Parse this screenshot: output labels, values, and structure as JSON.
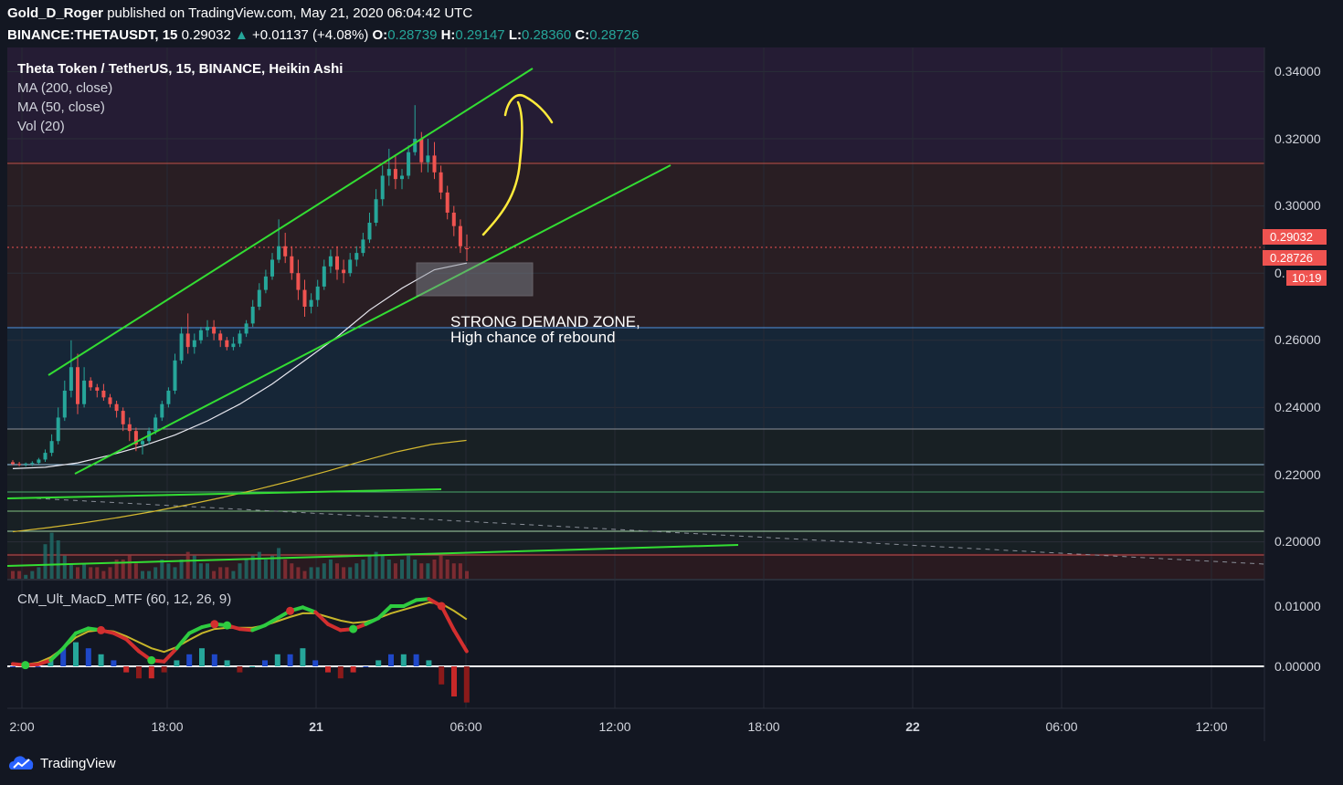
{
  "header": {
    "author": "Gold_D_Roger",
    "published": "published on TradingView.com, May 21, 2020 06:04:42 UTC",
    "symbol": "BINANCE:THETAUSDT, 15",
    "last": "0.29032",
    "change": "+0.01137 (+4.08%)",
    "open_label": "O:",
    "open": "0.28739",
    "high_label": "H:",
    "high": "0.29147",
    "low_label": "L:",
    "low": "0.28360",
    "close_label": "C:",
    "close": "0.28726"
  },
  "legend": {
    "title": "Theta Token / TetherUS, 15, BINANCE, Heikin Ashi",
    "ma200": "MA (200, close)",
    "ma50": "MA (50, close)",
    "vol": "Vol (20)",
    "macd": "CM_Ult_MacD_MTF (60, 12, 26, 9)"
  },
  "annotation": {
    "line1": "STRONG DEMAND ZONE,",
    "line2": "High chance of rebound"
  },
  "price_axis": {
    "ticks": [
      "0.34000",
      "0.32000",
      "0.30000",
      "0.26000",
      "0.24000",
      "0.22000",
      "0.20000"
    ],
    "badge_last": "0.29032",
    "badge_close": "0.28726",
    "badge_timer": "10:19",
    "partial": "0."
  },
  "macd_axis": {
    "ticks": [
      "0.01000",
      "0.00000"
    ]
  },
  "time_axis": {
    "ticks": [
      "2:00",
      "18:00",
      "21",
      "06:00",
      "12:00",
      "18:00",
      "22",
      "06:00",
      "12:00"
    ]
  },
  "brand": "TradingView",
  "colors": {
    "background": "#131722",
    "up": "#26a69a",
    "down": "#ef5350",
    "channel": "#33dd33",
    "ma200": "#d4b830",
    "ma50": "#e8e8f0",
    "annotation_arrow": "#ffeb3b"
  },
  "chart_data": {
    "type": "candlestick",
    "title": "Theta Token / TetherUS, 15, BINANCE, Heikin Ashi",
    "ylim": [
      0.19,
      0.345
    ],
    "candles": [
      [
        0.2237,
        0.2243,
        0.2228,
        0.2232
      ],
      [
        0.2232,
        0.2238,
        0.2225,
        0.223
      ],
      [
        0.223,
        0.2236,
        0.2224,
        0.2233
      ],
      [
        0.2233,
        0.224,
        0.2226,
        0.2235
      ],
      [
        0.2235,
        0.225,
        0.223,
        0.2245
      ],
      [
        0.2245,
        0.2275,
        0.2238,
        0.2265
      ],
      [
        0.2265,
        0.232,
        0.2255,
        0.23
      ],
      [
        0.23,
        0.24,
        0.229,
        0.237
      ],
      [
        0.237,
        0.248,
        0.236,
        0.245
      ],
      [
        0.245,
        0.26,
        0.243,
        0.252
      ],
      [
        0.252,
        0.256,
        0.238,
        0.241
      ],
      [
        0.241,
        0.252,
        0.24,
        0.248
      ],
      [
        0.248,
        0.249,
        0.245,
        0.246
      ],
      [
        0.246,
        0.247,
        0.243,
        0.245
      ],
      [
        0.245,
        0.247,
        0.242,
        0.243
      ],
      [
        0.243,
        0.244,
        0.24,
        0.241
      ],
      [
        0.241,
        0.242,
        0.237,
        0.239
      ],
      [
        0.239,
        0.24,
        0.233,
        0.235
      ],
      [
        0.235,
        0.237,
        0.23,
        0.233
      ],
      [
        0.233,
        0.234,
        0.227,
        0.229
      ],
      [
        0.229,
        0.231,
        0.226,
        0.23
      ],
      [
        0.23,
        0.234,
        0.229,
        0.233
      ],
      [
        0.233,
        0.238,
        0.232,
        0.237
      ],
      [
        0.237,
        0.242,
        0.236,
        0.241
      ],
      [
        0.241,
        0.246,
        0.24,
        0.245
      ],
      [
        0.245,
        0.256,
        0.244,
        0.254
      ],
      [
        0.254,
        0.264,
        0.253,
        0.262
      ],
      [
        0.262,
        0.268,
        0.256,
        0.258
      ],
      [
        0.258,
        0.262,
        0.256,
        0.26
      ],
      [
        0.26,
        0.264,
        0.259,
        0.263
      ],
      [
        0.263,
        0.266,
        0.261,
        0.264
      ],
      [
        0.264,
        0.266,
        0.26,
        0.262
      ],
      [
        0.262,
        0.263,
        0.258,
        0.26
      ],
      [
        0.26,
        0.261,
        0.257,
        0.258
      ],
      [
        0.258,
        0.261,
        0.257,
        0.259
      ],
      [
        0.259,
        0.263,
        0.258,
        0.262
      ],
      [
        0.262,
        0.266,
        0.261,
        0.265
      ],
      [
        0.265,
        0.272,
        0.264,
        0.27
      ],
      [
        0.27,
        0.277,
        0.269,
        0.275
      ],
      [
        0.275,
        0.281,
        0.274,
        0.279
      ],
      [
        0.279,
        0.286,
        0.278,
        0.284
      ],
      [
        0.284,
        0.296,
        0.283,
        0.288
      ],
      [
        0.288,
        0.292,
        0.283,
        0.285
      ],
      [
        0.285,
        0.288,
        0.278,
        0.28
      ],
      [
        0.28,
        0.284,
        0.272,
        0.275
      ],
      [
        0.275,
        0.278,
        0.267,
        0.27
      ],
      [
        0.27,
        0.274,
        0.268,
        0.272
      ],
      [
        0.272,
        0.278,
        0.27,
        0.276
      ],
      [
        0.276,
        0.284,
        0.275,
        0.282
      ],
      [
        0.282,
        0.287,
        0.28,
        0.285
      ],
      [
        0.285,
        0.288,
        0.278,
        0.281
      ],
      [
        0.281,
        0.284,
        0.277,
        0.28
      ],
      [
        0.28,
        0.286,
        0.279,
        0.284
      ],
      [
        0.284,
        0.288,
        0.282,
        0.286
      ],
      [
        0.286,
        0.292,
        0.285,
        0.29
      ],
      [
        0.29,
        0.298,
        0.289,
        0.295
      ],
      [
        0.295,
        0.305,
        0.294,
        0.302
      ],
      [
        0.302,
        0.312,
        0.3,
        0.309
      ],
      [
        0.309,
        0.317,
        0.306,
        0.311
      ],
      [
        0.311,
        0.315,
        0.305,
        0.308
      ],
      [
        0.308,
        0.311,
        0.305,
        0.309
      ],
      [
        0.309,
        0.318,
        0.308,
        0.316
      ],
      [
        0.316,
        0.33,
        0.315,
        0.32
      ],
      [
        0.32,
        0.322,
        0.31,
        0.313
      ],
      [
        0.313,
        0.32,
        0.31,
        0.315
      ],
      [
        0.315,
        0.319,
        0.308,
        0.31
      ],
      [
        0.31,
        0.312,
        0.302,
        0.304
      ],
      [
        0.304,
        0.306,
        0.296,
        0.298
      ],
      [
        0.298,
        0.3,
        0.291,
        0.294
      ],
      [
        0.294,
        0.296,
        0.286,
        0.288
      ],
      [
        0.2874,
        0.2915,
        0.2836,
        0.2873
      ]
    ],
    "ma200": [
      0.203,
      0.2042,
      0.2056,
      0.2072,
      0.209,
      0.211,
      0.2132,
      0.2156,
      0.2182,
      0.221,
      0.224,
      0.2268,
      0.229,
      0.2302
    ],
    "ma50": [
      0.2218,
      0.2222,
      0.2235,
      0.2258,
      0.2285,
      0.2318,
      0.236,
      0.241,
      0.247,
      0.254,
      0.261,
      0.269,
      0.2755,
      0.281,
      0.283
    ],
    "volume": [
      2,
      2,
      1,
      2,
      3,
      9,
      12,
      10,
      6,
      4,
      3,
      4,
      3,
      3,
      2,
      3,
      5,
      5,
      6,
      4,
      2,
      2,
      3,
      5,
      4,
      3,
      5,
      7,
      6,
      4,
      4,
      2,
      3,
      3,
      2,
      4,
      5,
      6,
      7,
      5,
      6,
      8,
      5,
      4,
      3,
      2,
      3,
      3,
      4,
      5,
      4,
      3,
      3,
      4,
      5,
      6,
      7,
      6,
      5,
      4,
      5,
      6,
      5,
      4,
      4,
      5,
      6,
      5,
      4,
      4,
      2
    ],
    "macd": [
      0.0004,
      0.0002,
      0.0003,
      0.001,
      0.003,
      0.0055,
      0.0063,
      0.006,
      0.0055,
      0.0045,
      0.0025,
      0.001,
      0.0008,
      0.003,
      0.0055,
      0.0065,
      0.007,
      0.0068,
      0.0062,
      0.006,
      0.0068,
      0.008,
      0.0092,
      0.0098,
      0.009,
      0.007,
      0.006,
      0.0062,
      0.007,
      0.008,
      0.01,
      0.01,
      0.011,
      0.0112,
      0.01,
      0.006,
      0.0025
    ],
    "signal": [
      0.0002,
      0.0003,
      0.0006,
      0.0015,
      0.003,
      0.0048,
      0.0058,
      0.006,
      0.0058,
      0.005,
      0.004,
      0.003,
      0.0024,
      0.0032,
      0.0044,
      0.0055,
      0.0062,
      0.0064,
      0.0064,
      0.0064,
      0.0068,
      0.0075,
      0.0082,
      0.0088,
      0.0088,
      0.0082,
      0.0076,
      0.0072,
      0.0074,
      0.008,
      0.0088,
      0.0094,
      0.01,
      0.0106,
      0.0104,
      0.0092,
      0.0078
    ],
    "histogram": [
      0,
      0,
      0,
      0.001,
      0.003,
      0.004,
      0.003,
      0.002,
      0.001,
      -0.001,
      -0.002,
      -0.002,
      -0.001,
      0.001,
      0.002,
      0.003,
      0.002,
      0.001,
      -0.001,
      0,
      0.001,
      0.002,
      0.002,
      0.003,
      0.001,
      -0.001,
      -0.002,
      -0.001,
      0,
      0.001,
      0.002,
      0.002,
      0.002,
      0.001,
      -0.003,
      -0.005,
      -0.006
    ]
  }
}
